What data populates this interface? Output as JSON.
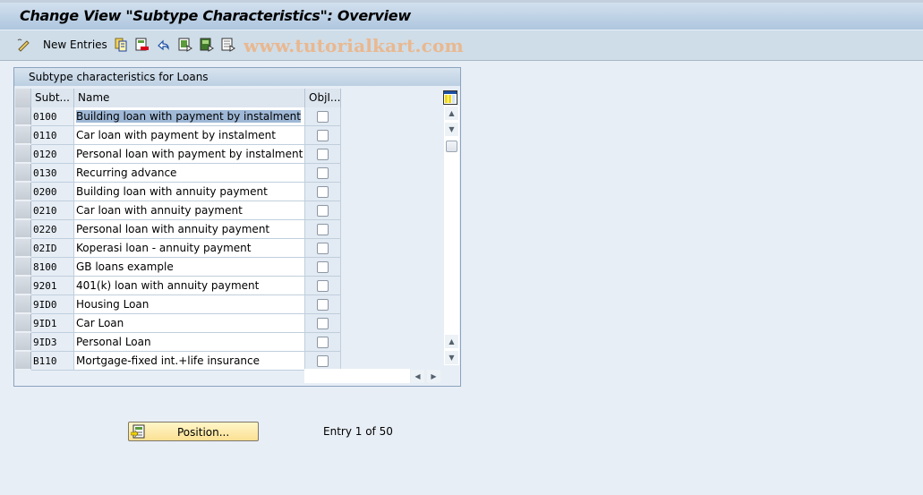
{
  "window": {
    "title": "Change View \"Subtype Characteristics\": Overview"
  },
  "toolbar": {
    "items": [
      {
        "icon": "edit-pencil-icon"
      },
      {
        "label": "New Entries"
      },
      {
        "icon": "copy-icon"
      },
      {
        "icon": "delete-icon"
      },
      {
        "icon": "undo-change-icon"
      },
      {
        "icon": "select-all-icon"
      },
      {
        "icon": "select-block-icon"
      },
      {
        "icon": "deselect-all-icon"
      }
    ],
    "new_entries_label": "New Entries"
  },
  "watermark": "www.tutorialkart.com",
  "table": {
    "title": "Subtype characteristics for Loans",
    "columns": [
      "Subt...",
      "Name",
      "ObjI..."
    ],
    "rows": [
      {
        "code": "0100",
        "name": "Building loan with payment by instalment",
        "obj": false,
        "selected": true
      },
      {
        "code": "0110",
        "name": "Car loan with payment by instalment",
        "obj": false
      },
      {
        "code": "0120",
        "name": "Personal loan with payment by instalment",
        "obj": false
      },
      {
        "code": "0130",
        "name": "Recurring advance",
        "obj": false
      },
      {
        "code": "0200",
        "name": "Building loan with annuity payment",
        "obj": false
      },
      {
        "code": "0210",
        "name": "Car loan with annuity payment",
        "obj": false
      },
      {
        "code": "0220",
        "name": "Personal loan with annuity payment",
        "obj": false
      },
      {
        "code": "02ID",
        "name": "Koperasi loan - annuity payment",
        "obj": false
      },
      {
        "code": "8100",
        "name": "GB loans example",
        "obj": false
      },
      {
        "code": "9201",
        "name": "401(k) loan with annuity payment",
        "obj": false
      },
      {
        "code": "9ID0",
        "name": "Housing Loan",
        "obj": false
      },
      {
        "code": "9ID1",
        "name": "Car Loan",
        "obj": false
      },
      {
        "code": "9ID3",
        "name": "Personal Loan",
        "obj": false
      },
      {
        "code": "B110",
        "name": "Mortgage-fixed int.+life insurance",
        "obj": false
      }
    ]
  },
  "footer": {
    "position_button": "Position...",
    "entry_info": "Entry 1 of 50"
  }
}
